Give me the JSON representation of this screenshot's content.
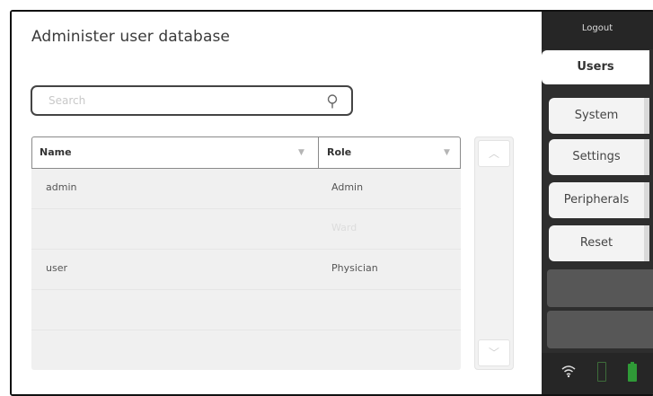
{
  "page": {
    "title": "Administer user database"
  },
  "search": {
    "placeholder": "Search",
    "value": "",
    "icon": "search-icon"
  },
  "table": {
    "columns": [
      "Name",
      "Role"
    ],
    "rows": [
      {
        "name": "admin",
        "role": "Admin"
      },
      {
        "name": "",
        "role": "Ward"
      },
      {
        "name": "user",
        "role": "Physician"
      },
      {
        "name": "",
        "role": ""
      }
    ]
  },
  "scroll": {
    "up_icon": "chevron-up-icon",
    "down_icon": "chevron-down-icon"
  },
  "sidebar": {
    "logout_label": "Logout",
    "tabs": [
      {
        "label": "Users",
        "active": true
      },
      {
        "label": "System"
      },
      {
        "label": "Settings"
      },
      {
        "label": "Peripherals"
      },
      {
        "label": "Reset"
      }
    ]
  },
  "status": {
    "icons": [
      "wifi-icon",
      "battery-empty-icon",
      "battery-full-icon"
    ],
    "accent_color": "#2f9a37"
  }
}
